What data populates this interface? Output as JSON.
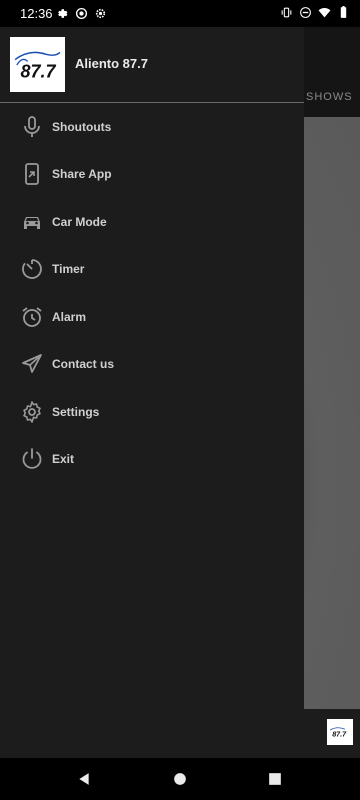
{
  "status_bar": {
    "time": "12:36",
    "left_icons": [
      "settings-gear-icon",
      "record-icon",
      "settings-gear-icon"
    ],
    "right_icons": [
      "vibrate-icon",
      "do-not-disturb-icon",
      "wifi-icon",
      "battery-icon"
    ]
  },
  "background_app": {
    "tab_label": "SHOWS"
  },
  "drawer": {
    "station_name": "Aliento 87.7",
    "logo_text": "87.7",
    "items": [
      {
        "label": "Shoutouts",
        "icon": "microphone-icon"
      },
      {
        "label": "Share App",
        "icon": "share-app-icon"
      },
      {
        "label": "Car Mode",
        "icon": "car-icon"
      },
      {
        "label": "Timer",
        "icon": "timer-icon"
      },
      {
        "label": "Alarm",
        "icon": "alarm-clock-icon"
      },
      {
        "label": "Contact us",
        "icon": "send-icon"
      },
      {
        "label": "Settings",
        "icon": "settings-icon"
      },
      {
        "label": "Exit",
        "icon": "power-icon"
      }
    ]
  },
  "nav_bar": {
    "buttons": [
      "back",
      "home",
      "recents"
    ]
  },
  "colors": {
    "drawer_bg": "#1c1c1c",
    "label": "#d0d0d0",
    "icon": "#9a9a9a"
  }
}
